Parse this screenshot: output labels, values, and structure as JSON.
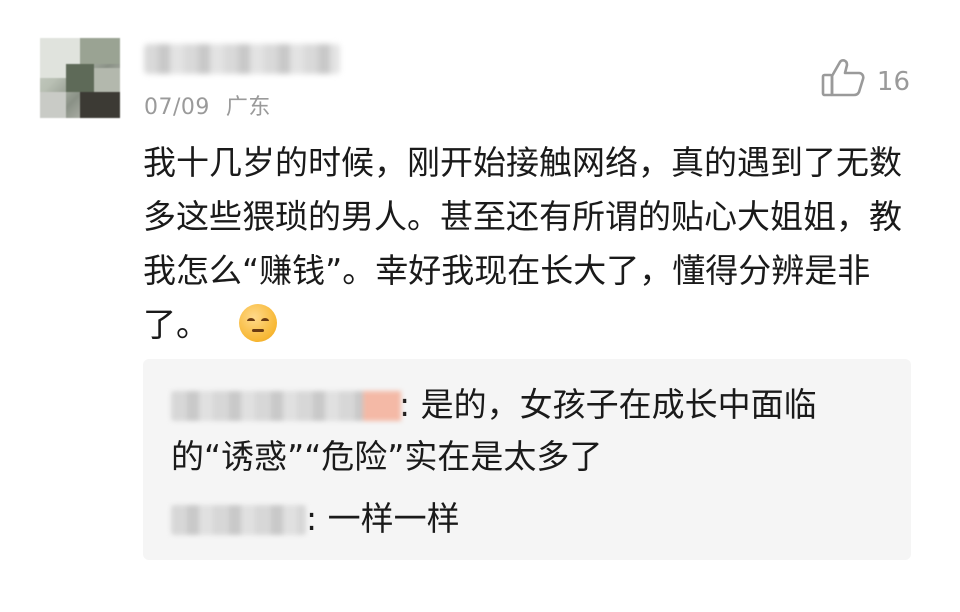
{
  "comment": {
    "avatar_icon": "user-avatar-blurred",
    "username": "",
    "date": "07/09",
    "location": "广东",
    "likes": "16",
    "like_icon": "thumbs-up-icon",
    "text": "我十几岁的时候，刚开始接触网络，真的遇到了无数多这些猥琐的男人。甚至还有所谓的贴心大姐姐，教我怎么“赚钱”。幸好我现在长大了，懂得分辨是非了。",
    "emoji": "pensive-face-emoji"
  },
  "replies": [
    {
      "name": "",
      "text": ": 是的，女孩子在成长中面临的“诱惑”“危险”实在是太多了"
    },
    {
      "name": "",
      "text": ": 一样一样"
    }
  ]
}
